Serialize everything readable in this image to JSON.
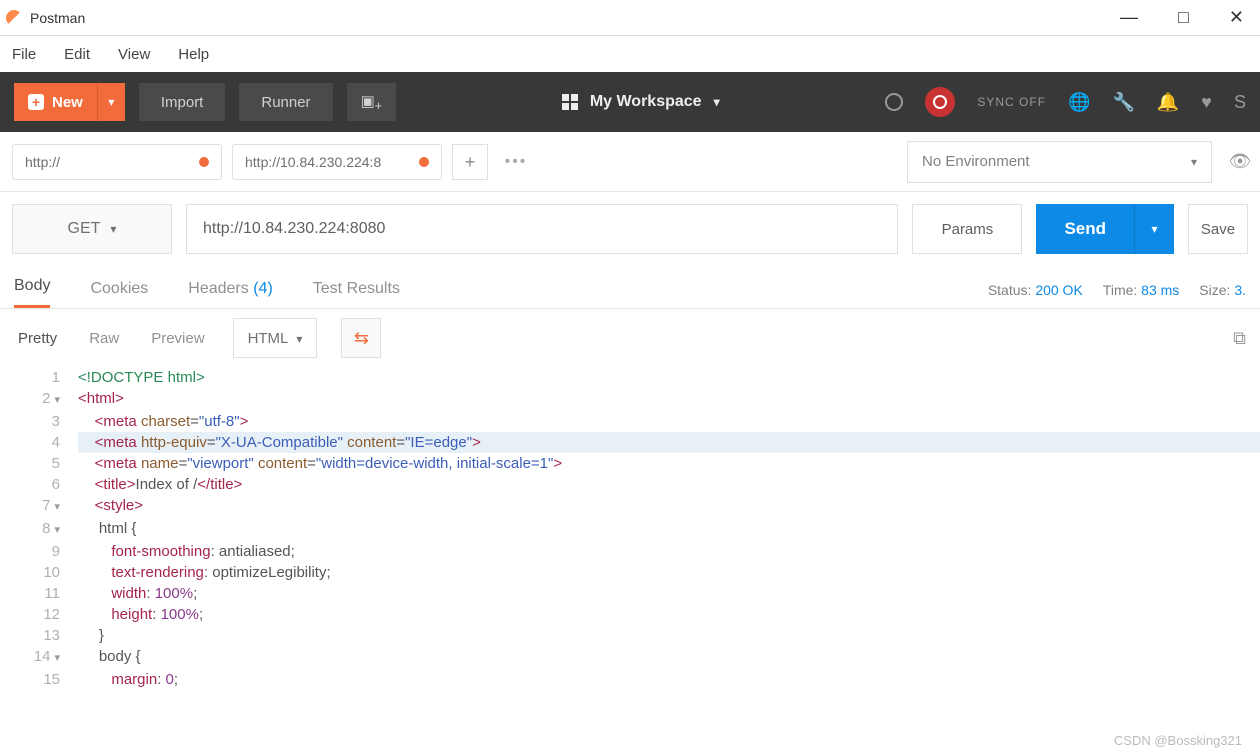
{
  "title_bar": {
    "app_name": "Postman"
  },
  "menu": {
    "file": "File",
    "edit": "Edit",
    "view": "View",
    "help": "Help"
  },
  "header": {
    "new_label": "New",
    "import_label": "Import",
    "runner_label": "Runner",
    "workspace_label": "My Workspace",
    "sync_label": "SYNC OFF"
  },
  "env": {
    "selected": "No Environment"
  },
  "tabs": [
    {
      "label": "http://",
      "dirty": true
    },
    {
      "label": "http://10.84.230.224:8",
      "dirty": true
    }
  ],
  "request": {
    "method": "GET",
    "url": "http://10.84.230.224:8080",
    "params_label": "Params",
    "send_label": "Send",
    "save_label": "Save"
  },
  "resp_tabs": {
    "body": "Body",
    "cookies": "Cookies",
    "headers": "Headers",
    "headers_count": "(4)",
    "tests": "Test Results"
  },
  "status": {
    "status_label": "Status:",
    "status_value": "200 OK",
    "time_label": "Time:",
    "time_value": "83 ms",
    "size_label": "Size:",
    "size_value": "3."
  },
  "view_bar": {
    "pretty": "Pretty",
    "raw": "Raw",
    "preview": "Preview",
    "format": "HTML"
  },
  "code_lines": [
    {
      "n": "1",
      "fold": "",
      "html": "<span class='t-kw'>&lt;!DOCTYPE html&gt;</span>"
    },
    {
      "n": "2",
      "fold": "▾",
      "html": "<span class='t-tag'>&lt;html&gt;</span>"
    },
    {
      "n": "3",
      "fold": "",
      "html": "    <span class='t-tag'>&lt;meta</span> <span class='t-attr'>charset</span>=<span class='t-str'>\"utf-8\"</span><span class='t-tag'>&gt;</span>"
    },
    {
      "n": "4",
      "fold": "",
      "hl": true,
      "html": "    <span class='t-tag'>&lt;meta</span> <span class='t-attr'>http-equiv</span>=<span class='t-str'>\"X-UA-Compatible\"</span> <span class='t-attr'>content</span>=<span class='t-str'>\"IE=edge\"</span><span class='t-tag'>&gt;</span>"
    },
    {
      "n": "5",
      "fold": "",
      "html": "    <span class='t-tag'>&lt;meta</span> <span class='t-attr'>name</span>=<span class='t-str'>\"viewport\"</span> <span class='t-attr'>content</span>=<span class='t-str'>\"width=device-width, initial-scale=1\"</span><span class='t-tag'>&gt;</span>"
    },
    {
      "n": "6",
      "fold": "",
      "html": "    <span class='t-tag'>&lt;title&gt;</span>Index of /<span class='t-tag'>&lt;/title&gt;</span>"
    },
    {
      "n": "7",
      "fold": "▾",
      "html": "    <span class='t-tag'>&lt;style&gt;</span>"
    },
    {
      "n": "8",
      "fold": "▾",
      "html": "     html {"
    },
    {
      "n": "9",
      "fold": "",
      "html": "        <span class='t-prop'>font-smoothing</span>: antialiased;"
    },
    {
      "n": "10",
      "fold": "",
      "html": "        <span class='t-prop'>text-rendering</span>: optimizeLegibility;"
    },
    {
      "n": "11",
      "fold": "",
      "html": "        <span class='t-prop'>width</span>: <span class='t-num'>100%</span>;"
    },
    {
      "n": "12",
      "fold": "",
      "html": "        <span class='t-prop'>height</span>: <span class='t-num'>100%</span>;"
    },
    {
      "n": "13",
      "fold": "",
      "html": "     }"
    },
    {
      "n": "14",
      "fold": "▾",
      "html": "     body {"
    },
    {
      "n": "15",
      "fold": "",
      "html": "        <span class='t-prop'>margin</span>: <span class='t-num'>0</span>;"
    }
  ],
  "watermark": "CSDN @Bossking321"
}
